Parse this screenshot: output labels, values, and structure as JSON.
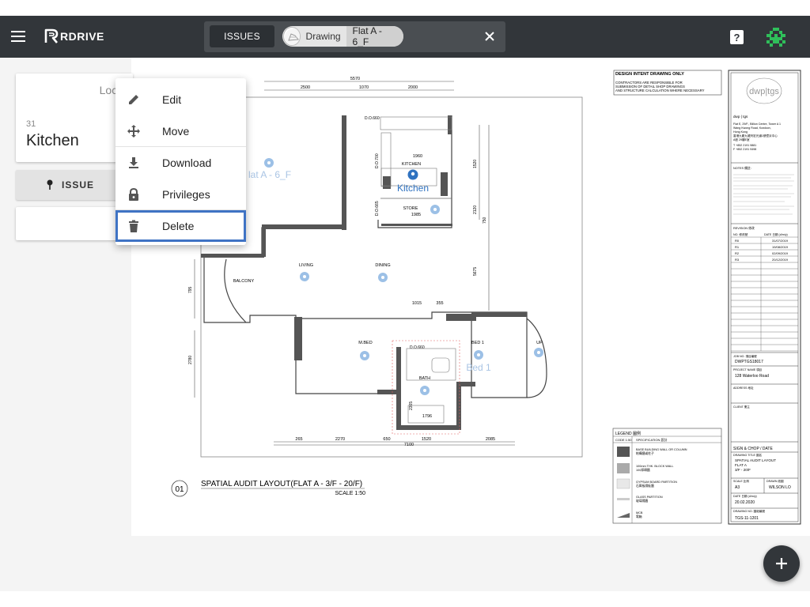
{
  "app": {
    "brand": "RDRIVE"
  },
  "header": {
    "issues_tab": "ISSUES",
    "chip": {
      "label": "Drawing",
      "value": "Flat A - 6_F"
    },
    "help": "?"
  },
  "location_card": {
    "label": "Loca",
    "number": "31",
    "name": "Kitchen"
  },
  "issue_button": {
    "label": "ISSUE"
  },
  "menu": {
    "items": [
      {
        "label": "Edit",
        "icon": "pencil-icon"
      },
      {
        "label": "Move",
        "icon": "move-arrows-icon"
      },
      {
        "label": "Download",
        "icon": "download-icon"
      },
      {
        "label": "Privileges",
        "icon": "lock-icon"
      },
      {
        "label": "Delete",
        "icon": "trash-icon",
        "selected": true
      }
    ]
  },
  "drawing": {
    "title": "SPATIAL AUDIT LAYOUT(FLAT A - 3/F - 20/F)",
    "scale": "SCALE 1:50",
    "number": "01",
    "flat_pin_label": "lat A - 6_F",
    "rooms": [
      "KITCHEN",
      "STORE",
      "LIVING",
      "DINING",
      "BALCONY",
      "M.BED",
      "BED 1",
      "UP",
      "BATH"
    ],
    "pins": {
      "kitchen": "Kitchen",
      "bed1": "Bed 1"
    },
    "dims_top": [
      "5570",
      "2500",
      "1070",
      "2000"
    ],
    "dims_bottom": [
      "265",
      "2270",
      "650",
      "1520",
      "2085",
      "7100"
    ],
    "dims_misc": [
      "1960",
      "1985",
      "1015",
      "355",
      "1520",
      "750",
      "2120",
      "5675",
      "795",
      "2780",
      "1796",
      "2365",
      "D.O.660",
      "D.O.700",
      "D.O.665",
      "D.O.660"
    ]
  },
  "title_block": {
    "notice": [
      "DESIGN INTENT DRAWING ONLY",
      "CONTRACTORS ARE RESPONSIBLE FOR",
      "SUBMISSION OF DETAIL SHOP DRAWINGS",
      "AND STRUCTURE CALCULATION WHERE NECESSARY"
    ],
    "logo": "dwp|tgs",
    "company": "dwp | tgs",
    "address": [
      "Flat E, 29/F., Billion Centre, Tower A 1",
      "Wang Kwong Road, Kowloon,",
      "Hong Kong",
      "香港九龍九龍灣宏光道1號億京中心",
      "A座 29樓E室",
      "T +852 2191 9881",
      "F +852 2191 9498"
    ],
    "notes_label": "NOTES 備註:",
    "revision_label": "REVISION 修改",
    "revision_header": [
      "NO. 修改號",
      "DATE 日期 (d/m/y)"
    ],
    "revisions": [
      {
        "no": "R0",
        "date": "31/07/2019"
      },
      {
        "no": "R1",
        "date": "19/08/2019"
      },
      {
        "no": "R2",
        "date": "02/09/2019"
      },
      {
        "no": "R3",
        "date": "20/12/2019"
      }
    ],
    "job_no_label": "JOB NO. 項目編號",
    "job_no": "DWPTGS18017",
    "project_label": "PROJECT NAME 項目",
    "project": "128 Waterloo Road",
    "address_label": "ADDRESS 地址",
    "client_label": "CLIENT 業主",
    "sign_label": "SIGN & CHOP / DATE",
    "drawing_title_label": "DRAWING TITLE 圖名",
    "drawing_title": [
      "SPATIAL AUDIT LAYOUT",
      "FLAT A",
      "3/F - 20/F"
    ],
    "scale_label": "SCALE 比例",
    "scale": "A3",
    "drawn_label": "DRAWN 繪圖",
    "drawn": "WILSON LO",
    "date_label": "DATE 日期 (d/m/y)",
    "date": "20.02.2020",
    "drawing_no_label": "DRAWING NO. 圖紙編號",
    "drawing_no": "TGS-11-1201"
  },
  "legend": {
    "title": "LEGEND 圖例",
    "header": [
      "CODE 1:50",
      "SPECIFICATION 設計"
    ],
    "items": [
      {
        "text": "BASE BUILDING WALL OR COLUMN",
        "sub": "結構牆或柱子"
      },
      {
        "text": "100mm THK. BLOCK WALL",
        "sub": "100厚磚牆"
      },
      {
        "text": "GYPSUM BOARD PARTITION",
        "sub": "石膏板隔板牆"
      },
      {
        "text": "GLASS PARTITION",
        "sub": "玻璃隔牆"
      },
      {
        "text": "MCB",
        "sub": "電箱"
      }
    ]
  },
  "fab": {
    "icon": "plus-icon"
  },
  "colors": {
    "appbar": "#32363a",
    "selection": "#3f73c4",
    "pin": "#5a8fd0"
  }
}
